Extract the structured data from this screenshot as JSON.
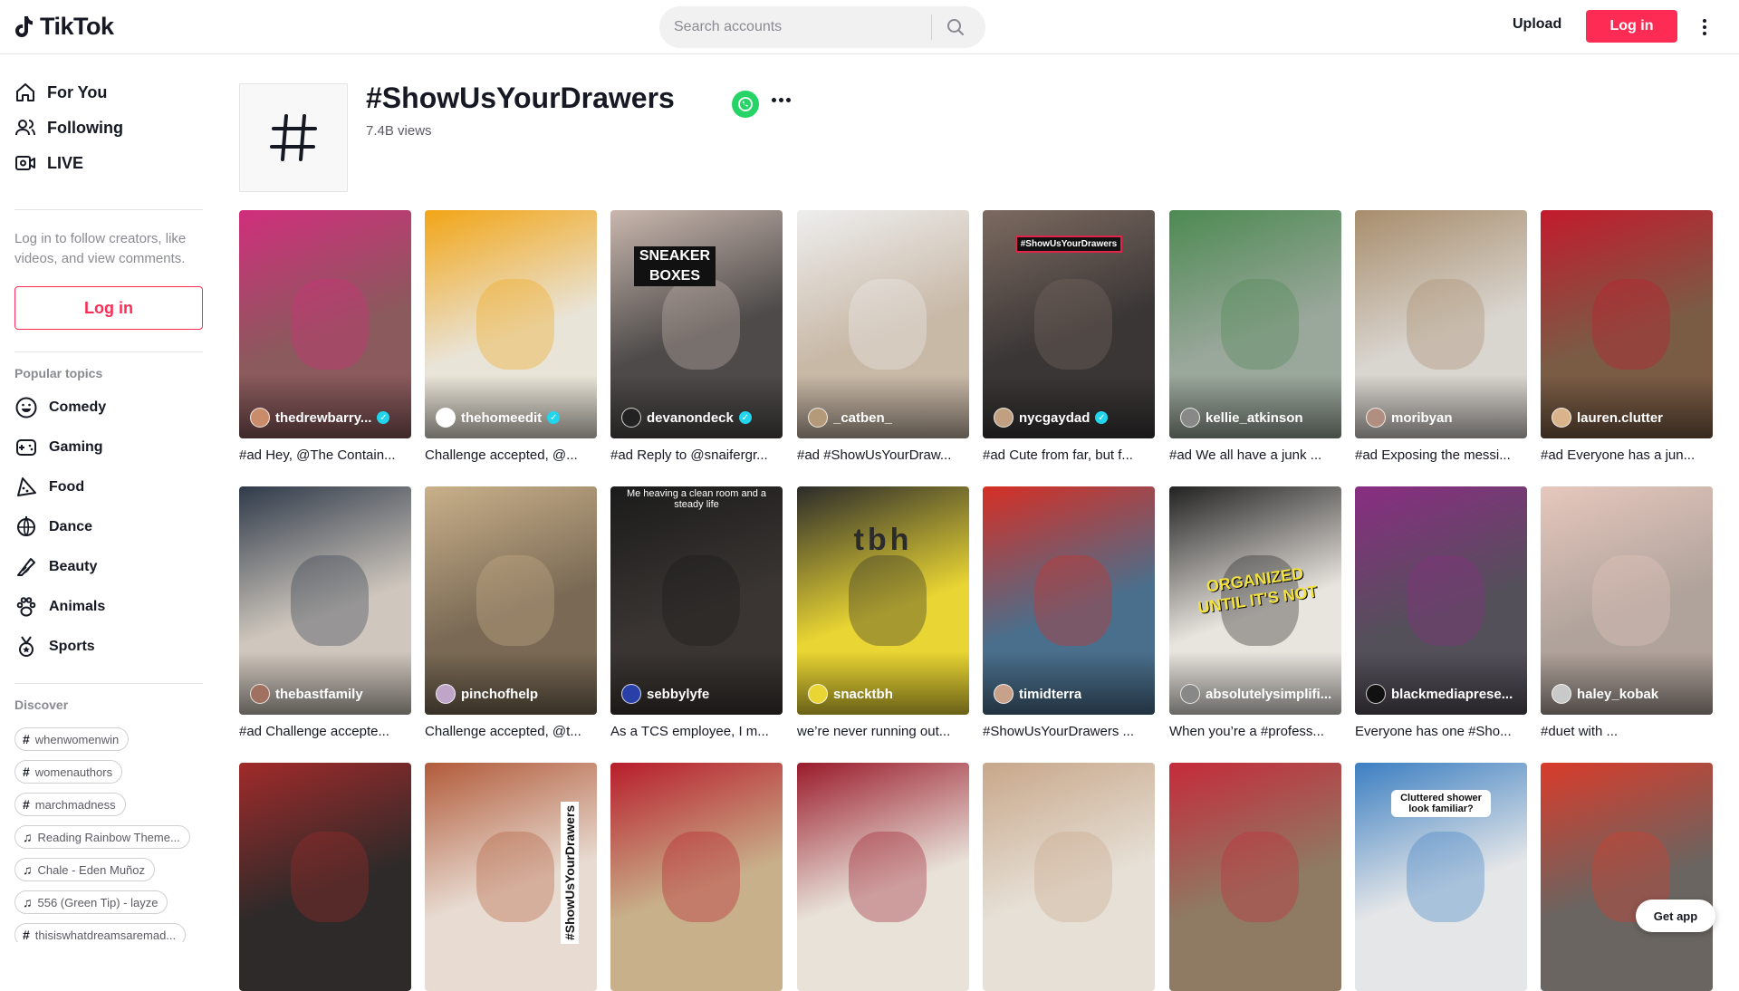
{
  "header": {
    "logo_text": "TikTok",
    "search_placeholder": "Search accounts",
    "upload_label": "Upload",
    "login_label": "Log in"
  },
  "sidebar": {
    "nav": [
      {
        "label": "For You",
        "icon": "home-icon"
      },
      {
        "label": "Following",
        "icon": "following-icon"
      },
      {
        "label": "LIVE",
        "icon": "live-icon"
      }
    ],
    "login_hint": "Log in to follow creators, like videos, and view comments.",
    "login_label": "Log in",
    "popular_title": "Popular topics",
    "topics": [
      {
        "label": "Comedy",
        "icon": "comedy-icon"
      },
      {
        "label": "Gaming",
        "icon": "gaming-icon"
      },
      {
        "label": "Food",
        "icon": "food-icon"
      },
      {
        "label": "Dance",
        "icon": "dance-icon"
      },
      {
        "label": "Beauty",
        "icon": "beauty-icon"
      },
      {
        "label": "Animals",
        "icon": "animals-icon"
      },
      {
        "label": "Sports",
        "icon": "sports-icon"
      }
    ],
    "discover_title": "Discover",
    "discover": [
      {
        "type": "hashtag",
        "label": "whenwomenwin"
      },
      {
        "type": "hashtag",
        "label": "womenauthors"
      },
      {
        "type": "hashtag",
        "label": "marchmadness"
      },
      {
        "type": "music",
        "label": "Reading Rainbow Theme..."
      },
      {
        "type": "music",
        "label": "Chale - Eden Muñoz"
      },
      {
        "type": "music",
        "label": "556 (Green Tip) - layze"
      },
      {
        "type": "hashtag",
        "label": "thisiswhatdreamsaremad..."
      }
    ]
  },
  "tag": {
    "title": "#ShowUsYourDrawers",
    "views": "7.4B views"
  },
  "videos": [
    {
      "user": "thedrewbarry...",
      "verified": true,
      "caption": "#ad Hey, @The Contain...",
      "bg": "#8a5a5c",
      "accent": "#d02e7c",
      "avatar": "#c98c6b"
    },
    {
      "user": "thehomeedit",
      "verified": true,
      "caption": "Challenge accepted, @...",
      "bg": "#e9e4d8",
      "accent": "#f2a516",
      "avatar": "#ffffff"
    },
    {
      "user": "devanondeck",
      "verified": true,
      "caption": "#ad Reply to @snaifergr...",
      "bg": "#4d4a49",
      "accent": "#c9b7ae",
      "avatar": "#222222"
    },
    {
      "user": "_catben_",
      "verified": false,
      "caption": "#ad #ShowUsYourDraw...",
      "bg": "#c8b8a6",
      "accent": "#eeeeee",
      "avatar": "#b59a7a"
    },
    {
      "user": "nycgaydad",
      "verified": true,
      "caption": "#ad Cute from far, but f...",
      "bg": "#3a3636",
      "accent": "#7c6a60",
      "avatar": "#c0a080"
    },
    {
      "user": "kellie_atkinson",
      "verified": false,
      "caption": "#ad We all have a junk ...",
      "bg": "#9aa79b",
      "accent": "#4d8a52",
      "avatar": "#888888"
    },
    {
      "user": "moribyan",
      "verified": false,
      "caption": "#ad Exposing the messi...",
      "bg": "#d9d5cf",
      "accent": "#a88d6c",
      "avatar": "#b18f80"
    },
    {
      "user": "lauren.clutter",
      "verified": false,
      "caption": "#ad Everyone has a jun...",
      "bg": "#7a5c45",
      "accent": "#c31a2d",
      "avatar": "#d9b48a"
    },
    {
      "user": "thebastfamily",
      "verified": false,
      "caption": "#ad Challenge accepte...",
      "bg": "#cfc7bd",
      "accent": "#2f3a4a",
      "avatar": "#a07060"
    },
    {
      "user": "pinchofhelp",
      "verified": false,
      "caption": "Challenge accepted, @t...",
      "bg": "#7a6a55",
      "accent": "#c9b08a",
      "avatar": "#bfa6c9"
    },
    {
      "user": "sebbylyfe",
      "verified": false,
      "caption": "As a TCS employee, I m...",
      "bg": "#3a3532",
      "accent": "#1b1b1b",
      "avatar": "#2940a8"
    },
    {
      "user": "snacktbh",
      "verified": false,
      "caption": "we’re never running out...",
      "bg": "#e9d533",
      "accent": "#2b2b2b",
      "avatar": "#e9d533"
    },
    {
      "user": "timidterra",
      "verified": false,
      "caption": "#ShowUsYourDrawers ...",
      "bg": "#4a6f8c",
      "accent": "#d62f25",
      "avatar": "#c7a18a"
    },
    {
      "user": "absolutelysimplifi...",
      "verified": false,
      "caption": "When you’re a #profess...",
      "bg": "#e8e4de",
      "accent": "#222222",
      "avatar": "#888888"
    },
    {
      "user": "blackmediaprese...",
      "verified": false,
      "caption": "Everyone has one #Sho...",
      "bg": "#54505a",
      "accent": "#8a2d83",
      "avatar": "#111111"
    },
    {
      "user": "haley_kobak",
      "verified": false,
      "caption": "#duet with ...",
      "bg": "#b0a39b",
      "accent": "#e6c7bd",
      "avatar": "#c9c9c9"
    },
    {
      "user": "",
      "verified": false,
      "caption": "",
      "bg": "#2e2a29",
      "accent": "#a12a2a",
      "avatar": ""
    },
    {
      "user": "",
      "verified": false,
      "caption": "",
      "bg": "#e8dcd2",
      "accent": "#b25b3a",
      "avatar": ""
    },
    {
      "user": "",
      "verified": false,
      "caption": "",
      "bg": "#c8b08a",
      "accent": "#b81d2b",
      "avatar": ""
    },
    {
      "user": "",
      "verified": false,
      "caption": "",
      "bg": "#e8e2d9",
      "accent": "#9a1b2b",
      "avatar": ""
    },
    {
      "user": "",
      "verified": false,
      "caption": "",
      "bg": "#e6e0d6",
      "accent": "#c8a78a",
      "avatar": ""
    },
    {
      "user": "",
      "verified": false,
      "caption": "",
      "bg": "#8f7a63",
      "accent": "#c52a3a",
      "avatar": ""
    },
    {
      "user": "",
      "verified": false,
      "caption": "",
      "bg": "#e4e6e8",
      "accent": "#3c7fc2",
      "avatar": ""
    },
    {
      "user": "",
      "verified": false,
      "caption": "",
      "bg": "#6a6561",
      "accent": "#d93b2a",
      "avatar": ""
    }
  ],
  "overlays": {
    "sneaker": "SNEAKER\nBOXES",
    "heaving": "Me heaving a clean room and a steady life",
    "organized": "ORGANIZED UNTIL IT'S NOT",
    "cluttered": "Cluttered shower look familiar?",
    "vertical_tag": "#ShowUsYourDrawers",
    "badge": "#ShowUsYourDrawers",
    "tbh": "tbh"
  },
  "get_app_label": "Get app",
  "colors": {
    "brand": "#fe2c55",
    "verified": "#20d5ec",
    "whatsapp": "#25d366"
  }
}
